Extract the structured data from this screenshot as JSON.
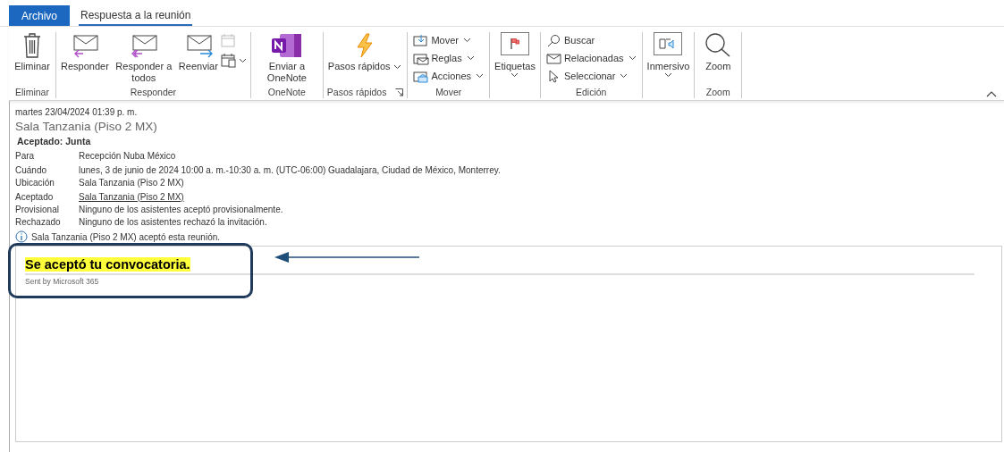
{
  "tabs": [
    {
      "label": "Archivo",
      "kind": "file",
      "selected": false
    },
    {
      "label": "Respuesta a la reunión",
      "kind": "tab",
      "selected": true
    }
  ],
  "ribbon": {
    "groups": [
      {
        "label": "Eliminar",
        "items": [
          {
            "kind": "large",
            "label": "Eliminar"
          }
        ]
      },
      {
        "label": "Responder",
        "items": [
          {
            "kind": "large",
            "label": "Responder"
          },
          {
            "kind": "large",
            "label": "Responder a todos"
          },
          {
            "kind": "large",
            "label": "Reenviar"
          },
          {
            "kind": "iconstack",
            "buttons": [
              {
                "disabled": true
              },
              {
                "disabled": false,
                "dropdown": true
              }
            ]
          }
        ]
      },
      {
        "label": "OneNote",
        "items": [
          {
            "kind": "large",
            "label": "Enviar a OneNote"
          }
        ]
      },
      {
        "label": "Pasos rápidos",
        "launcher": true,
        "items": [
          {
            "kind": "large",
            "label": "Pasos rápidos",
            "dropdown": true
          }
        ]
      },
      {
        "label": "Mover",
        "items": [
          {
            "kind": "smallstack",
            "buttons": [
              {
                "label": "Mover",
                "dropdown": true
              },
              {
                "label": "Reglas",
                "dropdown": true
              },
              {
                "label": "Acciones",
                "dropdown": true
              }
            ]
          }
        ]
      },
      {
        "items": [
          {
            "kind": "boxed",
            "label": "Etiquetas",
            "dropdown": true
          }
        ]
      },
      {
        "label": "Edición",
        "items": [
          {
            "kind": "smallstack",
            "buttons": [
              {
                "label": "Buscar"
              },
              {
                "label": "Relacionadas",
                "dropdown": true
              },
              {
                "label": "Seleccionar",
                "dropdown": true
              }
            ]
          }
        ]
      },
      {
        "items": [
          {
            "kind": "boxed",
            "label": "Inmersivo",
            "dropdown": true
          }
        ]
      },
      {
        "label": "Zoom",
        "items": [
          {
            "kind": "large",
            "label": "Zoom"
          }
        ]
      }
    ]
  },
  "message": {
    "date": "martes 23/04/2024 01:39 p. m.",
    "subject": "Sala Tanzania (Piso 2 MX)",
    "status": "Aceptado: Junta",
    "field_groups": [
      [
        {
          "label": "Para",
          "value": "Recepción Nuba México"
        }
      ],
      [
        {
          "label": "Cuándo",
          "value": "lunes, 3 de junio de 2024 10:00 a. m.-10:30 a. m. (UTC-06:00) Guadalajara, Ciudad de México, Monterrey."
        },
        {
          "label": "Ubicación",
          "value": "Sala Tanzania (Piso 2 MX)"
        }
      ],
      [
        {
          "label": "Aceptado",
          "value": "Sala Tanzania (Piso 2 MX)",
          "link": true
        },
        {
          "label": "Provisional",
          "value": "Ninguno de los asistentes aceptó provisionalmente."
        },
        {
          "label": "Rechazado",
          "value": "Ninguno de los asistentes rechazó la invitación."
        }
      ]
    ],
    "info": "Sala Tanzania (Piso 2 MX) aceptó esta reunión.",
    "body": {
      "heading": "Se aceptó tu convocatoria.",
      "footer": "Sent by Microsoft 365"
    }
  }
}
